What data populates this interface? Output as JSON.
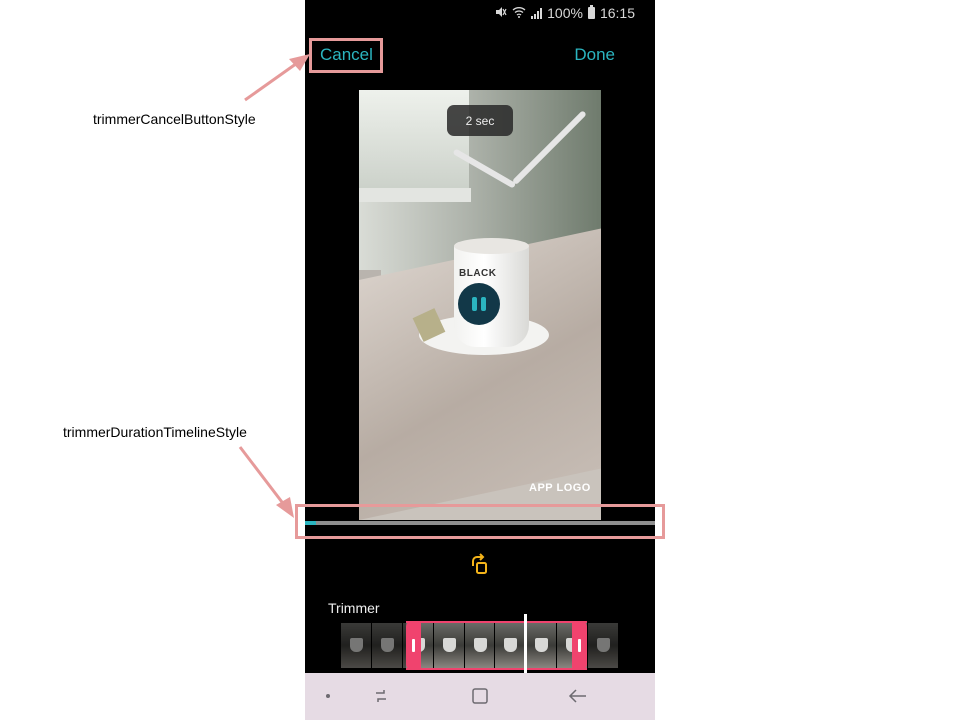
{
  "status_bar": {
    "battery": "100%",
    "time": "16:15"
  },
  "toolbar": {
    "cancel_label": "Cancel",
    "done_label": "Done"
  },
  "video": {
    "duration_bubble": "2 sec",
    "watermark": "APP LOGO",
    "cup_print": "BLACK",
    "state": "playing"
  },
  "timeline": {
    "progress_fraction": 0.03,
    "fill_color": "#2bb5c0",
    "track_color": "#8e8e8e"
  },
  "trimmer": {
    "title": "Trimmer",
    "frame_count": 9,
    "handle_color": "#f0436e"
  },
  "annotations": {
    "cancel_label": "trimmerCancelButtonStyle",
    "timeline_label": "trimmerDurationTimelineStyle",
    "highlight_color": "#e69a9a"
  },
  "icons": {
    "pause": "pause-icon",
    "rotate": "rotate-icon",
    "recents": "recent-apps-icon",
    "home": "home-icon",
    "back": "back-icon"
  }
}
